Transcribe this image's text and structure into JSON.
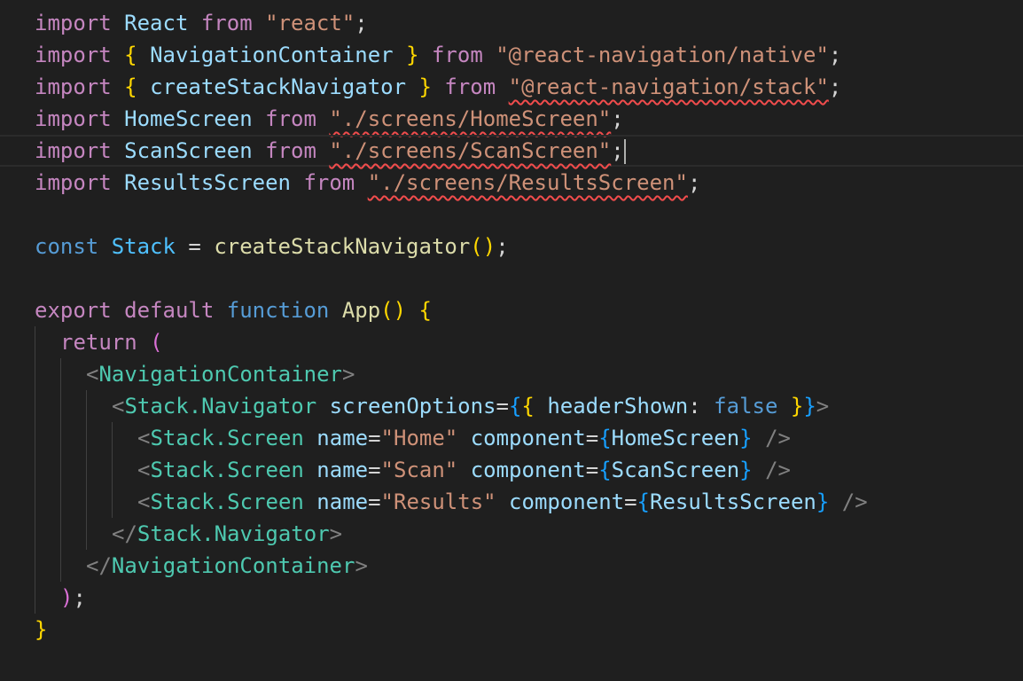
{
  "colors": {
    "background": "#1f1f1f",
    "keyword_control": "#c586c0",
    "keyword_storage": "#569cd6",
    "identifier": "#9cdcfe",
    "constant": "#4fc1ff",
    "function": "#dcdcaa",
    "string": "#ce9178",
    "jsx_tag": "#4ec9b0",
    "jsx_bracket": "#808080",
    "bracket_gold": "#ffd700",
    "bracket_pink": "#da70d6",
    "bracket_blue": "#179fff",
    "plain": "#d4d4d4",
    "error_squiggle": "#f14c4c"
  },
  "editor": {
    "cursor_line": 5,
    "lines": [
      {
        "indent": 0,
        "tokens": [
          {
            "text": "import",
            "kind": "keyword_control"
          },
          {
            "text": " ",
            "kind": "plain"
          },
          {
            "text": "React",
            "kind": "identifier"
          },
          {
            "text": " ",
            "kind": "plain"
          },
          {
            "text": "from",
            "kind": "keyword_control"
          },
          {
            "text": " ",
            "kind": "plain"
          },
          {
            "text": "\"react\"",
            "kind": "string"
          },
          {
            "text": ";",
            "kind": "plain"
          }
        ]
      },
      {
        "indent": 0,
        "tokens": [
          {
            "text": "import",
            "kind": "keyword_control"
          },
          {
            "text": " ",
            "kind": "plain"
          },
          {
            "text": "{",
            "kind": "bracket_gold"
          },
          {
            "text": " ",
            "kind": "plain"
          },
          {
            "text": "NavigationContainer",
            "kind": "identifier"
          },
          {
            "text": " ",
            "kind": "plain"
          },
          {
            "text": "}",
            "kind": "bracket_gold"
          },
          {
            "text": " ",
            "kind": "plain"
          },
          {
            "text": "from",
            "kind": "keyword_control"
          },
          {
            "text": " ",
            "kind": "plain"
          },
          {
            "text": "\"@react-navigation/native\"",
            "kind": "string"
          },
          {
            "text": ";",
            "kind": "plain"
          }
        ]
      },
      {
        "indent": 0,
        "tokens": [
          {
            "text": "import",
            "kind": "keyword_control"
          },
          {
            "text": " ",
            "kind": "plain"
          },
          {
            "text": "{",
            "kind": "bracket_gold"
          },
          {
            "text": " ",
            "kind": "plain"
          },
          {
            "text": "createStackNavigator",
            "kind": "identifier"
          },
          {
            "text": " ",
            "kind": "plain"
          },
          {
            "text": "}",
            "kind": "bracket_gold"
          },
          {
            "text": " ",
            "kind": "plain"
          },
          {
            "text": "from",
            "kind": "keyword_control"
          },
          {
            "text": " ",
            "kind": "plain"
          },
          {
            "text": "\"@react-navigation/stack\"",
            "kind": "string",
            "error": true
          },
          {
            "text": ";",
            "kind": "plain"
          }
        ]
      },
      {
        "indent": 0,
        "tokens": [
          {
            "text": "import",
            "kind": "keyword_control"
          },
          {
            "text": " ",
            "kind": "plain"
          },
          {
            "text": "HomeScreen",
            "kind": "identifier"
          },
          {
            "text": " ",
            "kind": "plain"
          },
          {
            "text": "from",
            "kind": "keyword_control"
          },
          {
            "text": " ",
            "kind": "plain"
          },
          {
            "text": "\"./screens/HomeScreen\"",
            "kind": "string",
            "error": true
          },
          {
            "text": ";",
            "kind": "plain"
          }
        ]
      },
      {
        "indent": 0,
        "active": true,
        "tokens": [
          {
            "text": "import",
            "kind": "keyword_control"
          },
          {
            "text": " ",
            "kind": "plain"
          },
          {
            "text": "ScanScreen",
            "kind": "identifier"
          },
          {
            "text": " ",
            "kind": "plain"
          },
          {
            "text": "from",
            "kind": "keyword_control"
          },
          {
            "text": " ",
            "kind": "plain"
          },
          {
            "text": "\"./screens/ScanScreen\"",
            "kind": "string",
            "error": true
          },
          {
            "text": ";",
            "kind": "plain"
          },
          {
            "text": "",
            "kind": "cursor"
          }
        ]
      },
      {
        "indent": 0,
        "tokens": [
          {
            "text": "import",
            "kind": "keyword_control"
          },
          {
            "text": " ",
            "kind": "plain"
          },
          {
            "text": "ResultsScreen",
            "kind": "identifier"
          },
          {
            "text": " ",
            "kind": "plain"
          },
          {
            "text": "from",
            "kind": "keyword_control"
          },
          {
            "text": " ",
            "kind": "plain"
          },
          {
            "text": "\"./screens/ResultsScreen\"",
            "kind": "string",
            "error": true
          },
          {
            "text": ";",
            "kind": "plain"
          }
        ]
      },
      {
        "indent": 0,
        "tokens": []
      },
      {
        "indent": 0,
        "tokens": [
          {
            "text": "const",
            "kind": "keyword_storage"
          },
          {
            "text": " ",
            "kind": "plain"
          },
          {
            "text": "Stack",
            "kind": "constant"
          },
          {
            "text": " = ",
            "kind": "plain"
          },
          {
            "text": "createStackNavigator",
            "kind": "function"
          },
          {
            "text": "()",
            "kind": "bracket_gold"
          },
          {
            "text": ";",
            "kind": "plain"
          }
        ]
      },
      {
        "indent": 0,
        "tokens": []
      },
      {
        "indent": 0,
        "tokens": [
          {
            "text": "export",
            "kind": "keyword_control"
          },
          {
            "text": " ",
            "kind": "plain"
          },
          {
            "text": "default",
            "kind": "keyword_control"
          },
          {
            "text": " ",
            "kind": "plain"
          },
          {
            "text": "function",
            "kind": "keyword_storage"
          },
          {
            "text": " ",
            "kind": "plain"
          },
          {
            "text": "App",
            "kind": "function"
          },
          {
            "text": "()",
            "kind": "bracket_gold"
          },
          {
            "text": " ",
            "kind": "plain"
          },
          {
            "text": "{",
            "kind": "bracket_gold"
          }
        ]
      },
      {
        "indent": 1,
        "tokens": [
          {
            "text": "return",
            "kind": "keyword_control"
          },
          {
            "text": " ",
            "kind": "plain"
          },
          {
            "text": "(",
            "kind": "bracket_pink"
          }
        ]
      },
      {
        "indent": 2,
        "tokens": [
          {
            "text": "<",
            "kind": "jsx_bracket"
          },
          {
            "text": "NavigationContainer",
            "kind": "jsx_tag"
          },
          {
            "text": ">",
            "kind": "jsx_bracket"
          }
        ]
      },
      {
        "indent": 3,
        "tokens": [
          {
            "text": "<",
            "kind": "jsx_bracket"
          },
          {
            "text": "Stack.Navigator",
            "kind": "jsx_tag"
          },
          {
            "text": " ",
            "kind": "plain"
          },
          {
            "text": "screenOptions",
            "kind": "identifier"
          },
          {
            "text": "=",
            "kind": "plain"
          },
          {
            "text": "{",
            "kind": "bracket_blue"
          },
          {
            "text": "{",
            "kind": "bracket_gold"
          },
          {
            "text": " ",
            "kind": "plain"
          },
          {
            "text": "headerShown",
            "kind": "identifier"
          },
          {
            "text": ": ",
            "kind": "plain"
          },
          {
            "text": "false",
            "kind": "keyword_storage"
          },
          {
            "text": " ",
            "kind": "plain"
          },
          {
            "text": "}",
            "kind": "bracket_gold"
          },
          {
            "text": "}",
            "kind": "bracket_blue"
          },
          {
            "text": ">",
            "kind": "jsx_bracket"
          }
        ]
      },
      {
        "indent": 4,
        "tokens": [
          {
            "text": "<",
            "kind": "jsx_bracket"
          },
          {
            "text": "Stack.Screen",
            "kind": "jsx_tag"
          },
          {
            "text": " ",
            "kind": "plain"
          },
          {
            "text": "name",
            "kind": "identifier"
          },
          {
            "text": "=",
            "kind": "plain"
          },
          {
            "text": "\"Home\"",
            "kind": "string"
          },
          {
            "text": " ",
            "kind": "plain"
          },
          {
            "text": "component",
            "kind": "identifier"
          },
          {
            "text": "=",
            "kind": "plain"
          },
          {
            "text": "{",
            "kind": "bracket_blue"
          },
          {
            "text": "HomeScreen",
            "kind": "identifier"
          },
          {
            "text": "}",
            "kind": "bracket_blue"
          },
          {
            "text": " ",
            "kind": "plain"
          },
          {
            "text": "/>",
            "kind": "jsx_bracket"
          }
        ]
      },
      {
        "indent": 4,
        "tokens": [
          {
            "text": "<",
            "kind": "jsx_bracket"
          },
          {
            "text": "Stack.Screen",
            "kind": "jsx_tag"
          },
          {
            "text": " ",
            "kind": "plain"
          },
          {
            "text": "name",
            "kind": "identifier"
          },
          {
            "text": "=",
            "kind": "plain"
          },
          {
            "text": "\"Scan\"",
            "kind": "string"
          },
          {
            "text": " ",
            "kind": "plain"
          },
          {
            "text": "component",
            "kind": "identifier"
          },
          {
            "text": "=",
            "kind": "plain"
          },
          {
            "text": "{",
            "kind": "bracket_blue"
          },
          {
            "text": "ScanScreen",
            "kind": "identifier"
          },
          {
            "text": "}",
            "kind": "bracket_blue"
          },
          {
            "text": " ",
            "kind": "plain"
          },
          {
            "text": "/>",
            "kind": "jsx_bracket"
          }
        ]
      },
      {
        "indent": 4,
        "tokens": [
          {
            "text": "<",
            "kind": "jsx_bracket"
          },
          {
            "text": "Stack.Screen",
            "kind": "jsx_tag"
          },
          {
            "text": " ",
            "kind": "plain"
          },
          {
            "text": "name",
            "kind": "identifier"
          },
          {
            "text": "=",
            "kind": "plain"
          },
          {
            "text": "\"Results\"",
            "kind": "string"
          },
          {
            "text": " ",
            "kind": "plain"
          },
          {
            "text": "component",
            "kind": "identifier"
          },
          {
            "text": "=",
            "kind": "plain"
          },
          {
            "text": "{",
            "kind": "bracket_blue"
          },
          {
            "text": "ResultsScreen",
            "kind": "identifier"
          },
          {
            "text": "}",
            "kind": "bracket_blue"
          },
          {
            "text": " ",
            "kind": "plain"
          },
          {
            "text": "/>",
            "kind": "jsx_bracket"
          }
        ]
      },
      {
        "indent": 3,
        "tokens": [
          {
            "text": "</",
            "kind": "jsx_bracket"
          },
          {
            "text": "Stack.Navigator",
            "kind": "jsx_tag"
          },
          {
            "text": ">",
            "kind": "jsx_bracket"
          }
        ]
      },
      {
        "indent": 2,
        "tokens": [
          {
            "text": "</",
            "kind": "jsx_bracket"
          },
          {
            "text": "NavigationContainer",
            "kind": "jsx_tag"
          },
          {
            "text": ">",
            "kind": "jsx_bracket"
          }
        ]
      },
      {
        "indent": 1,
        "tokens": [
          {
            "text": ")",
            "kind": "bracket_pink"
          },
          {
            "text": ";",
            "kind": "plain"
          }
        ]
      },
      {
        "indent": 0,
        "tokens": [
          {
            "text": "}",
            "kind": "bracket_gold"
          }
        ]
      }
    ]
  }
}
